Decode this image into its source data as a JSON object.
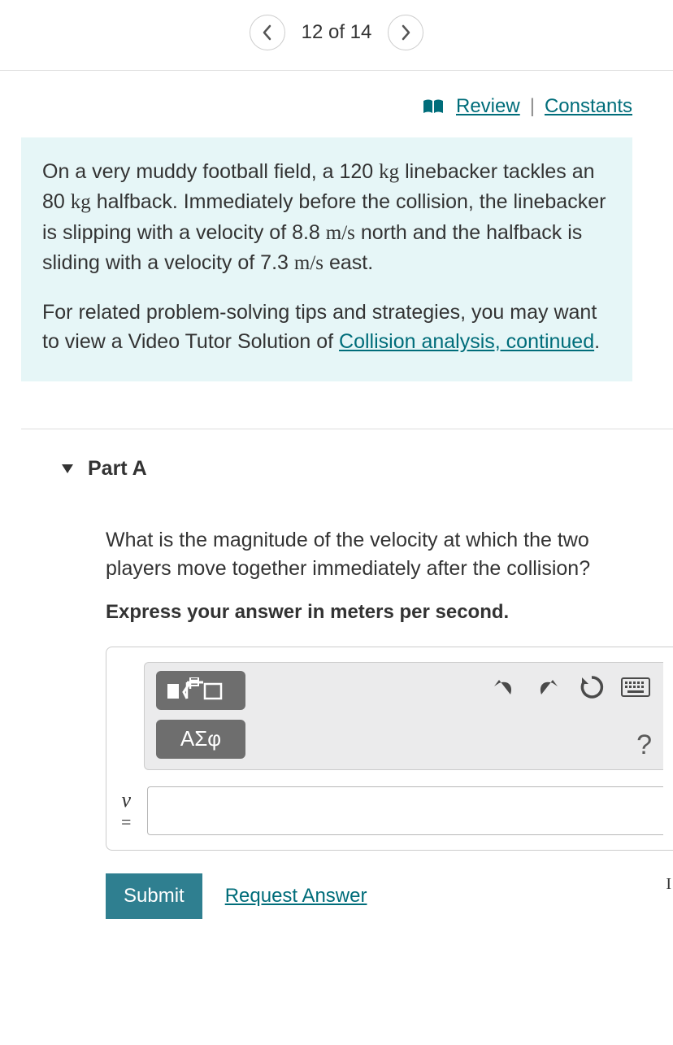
{
  "pager": {
    "label": "12 of 14"
  },
  "links": {
    "review": "Review",
    "separator": "|",
    "constants": "Constants"
  },
  "problem": {
    "p1_a": "On a very muddy football field, a 120 ",
    "p1_unit1": "kg",
    "p1_b": " linebacker tackles an 80 ",
    "p1_unit2": "kg",
    "p1_c": " halfback. Immediately before the collision, the linebacker is slipping with a velocity of 8.8 ",
    "p1_unit3": "m/s",
    "p1_d": " north and the halfback is sliding with a velocity of 7.3 ",
    "p1_unit4": "m/s",
    "p1_e": " east.",
    "p2_a": "For related problem-solving tips and strategies, you may want to view a Video Tutor Solution of ",
    "p2_link": "Collision analysis, continued",
    "p2_b": "."
  },
  "part": {
    "label": "Part A"
  },
  "question": {
    "text": "What is the magnitude of the velocity at which the two players move together immediately after the collision?",
    "instruction": "Express your answer in meters per second."
  },
  "toolbar": {
    "greek_label": "ΑΣφ",
    "help": "?"
  },
  "input": {
    "variable": "v",
    "equals": "=",
    "value": ""
  },
  "actions": {
    "submit": "Submit",
    "request": "Request Answer"
  },
  "cursor": "I"
}
